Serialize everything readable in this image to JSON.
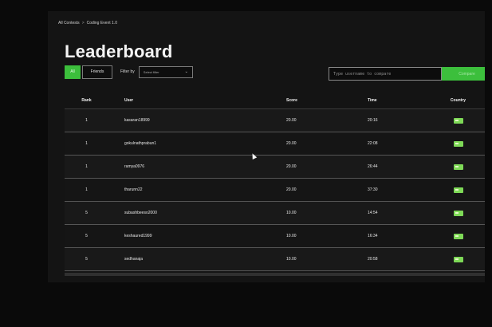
{
  "breadcrumb": {
    "items": [
      "All Contests",
      "Coding Event 1.0"
    ],
    "separator": ">"
  },
  "page_title": "Leaderboard",
  "toolbar": {
    "all_label": "All",
    "friends_label": "Friends",
    "filter_label": "Filter by",
    "filter_placeholder": "Select filter"
  },
  "compare": {
    "placeholder": "Type username to compare",
    "button_label": "Compare"
  },
  "table": {
    "columns": [
      "Rank",
      "User",
      "Score",
      "Time",
      "Country"
    ],
    "rows": [
      {
        "rank": "1",
        "user": "kasaran18999",
        "score": "20.00",
        "time": "20:16",
        "country_icon": "flag-icon"
      },
      {
        "rank": "1",
        "user": "gokulnathprabun1",
        "score": "20.00",
        "time": "22:08",
        "country_icon": "flag-icon"
      },
      {
        "rank": "1",
        "user": "ramya0976",
        "score": "20.00",
        "time": "26:44",
        "country_icon": "flag-icon"
      },
      {
        "rank": "1",
        "user": "tharunn22",
        "score": "20.00",
        "time": "37:30",
        "country_icon": "flag-icon"
      },
      {
        "rank": "5",
        "user": "subashbeeso2000",
        "score": "10.00",
        "time": "14:54",
        "country_icon": "flag-icon"
      },
      {
        "rank": "5",
        "user": "keshaured1999",
        "score": "10.00",
        "time": "16:34",
        "country_icon": "flag-icon"
      },
      {
        "rank": "5",
        "user": "sedhanaja",
        "score": "10.00",
        "time": "20:58",
        "country_icon": "flag-icon"
      }
    ]
  },
  "colors": {
    "accent_green": "#3cbf3c",
    "background": "#141414"
  }
}
